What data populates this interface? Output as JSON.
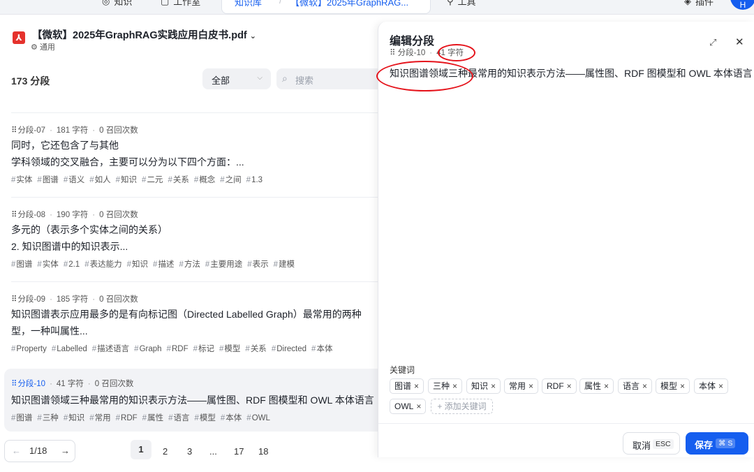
{
  "topbar": {
    "nav1": "知识",
    "nav2": "工作室",
    "tab_left": "知识库",
    "tab_right": "【微软】2025年GraphRAG...",
    "nav3": "工具",
    "plugins": "插件",
    "avatar": "H"
  },
  "doc": {
    "title": "【微软】2025年GraphRAG实践应用白皮书.pdf",
    "chevron": "⌄",
    "subtitle": "通用"
  },
  "list": {
    "count": "173 分段",
    "filter": "全部",
    "search_placeholder": "搜索"
  },
  "segments": [
    {
      "id": "分段-07",
      "chars": "181 字符",
      "recalls": "0 召回次数",
      "lines": [
        "同时，它还包含了与其他",
        "学科领域的交叉融合，主要可以分为以下四个方面：..."
      ],
      "tags": [
        "实体",
        "图谱",
        "语义",
        "如人",
        "知识",
        "二元",
        "关系",
        "概念",
        "之间",
        "1.3"
      ]
    },
    {
      "id": "分段-08",
      "chars": "190 字符",
      "recalls": "0 召回次数",
      "lines": [
        "多元的（表示多个实体之间的关系）",
        "2. 知识图谱中的知识表示..."
      ],
      "tags": [
        "图谱",
        "实体",
        "2.1",
        "表达能力",
        "知识",
        "描述",
        "方法",
        "主要用途",
        "表示",
        "建模"
      ]
    },
    {
      "id": "分段-09",
      "chars": "185 字符",
      "recalls": "0 召回次数",
      "lines": [
        "知识图谱表示应用最多的是有向标记图（Directed Labelled Graph）最常用的两种",
        "型，一种叫属性..."
      ],
      "tags": [
        "Property",
        "Labelled",
        "描述语言",
        "Graph",
        "RDF",
        "标记",
        "模型",
        "关系",
        "Directed",
        "本体"
      ]
    },
    {
      "id": "分段-10",
      "chars": "41 字符",
      "recalls": "0 召回次数",
      "lines": [
        "知识图谱领域三种最常用的知识表示方法——属性图、RDF 图模型和 OWL 本体语言"
      ],
      "tags": [
        "图谱",
        "三种",
        "知识",
        "常用",
        "RDF",
        "属性",
        "语言",
        "模型",
        "本体",
        "OWL"
      ]
    }
  ],
  "pager": {
    "current": "1/18",
    "pages": [
      "1",
      "2",
      "3",
      "...",
      "17",
      "18"
    ]
  },
  "panel": {
    "title": "编辑分段",
    "segment_id": "分段-10",
    "chars": "41 字符",
    "content": "知识图谱领域三种最常用的知识表示方法——属性图、RDF 图模型和 OWL 本体语言",
    "keywords_label": "关键词",
    "keywords": [
      "图谱",
      "三种",
      "知识",
      "常用",
      "RDF",
      "属性",
      "语言",
      "模型",
      "本体",
      "OWL"
    ],
    "add_keyword": "+ 添加关键词",
    "cancel": "取消",
    "cancel_key": "ESC",
    "save": "保存",
    "save_key": "⌘ S"
  },
  "colors": {
    "accent": "#155eef",
    "highlight_annotation": "#e5131b",
    "pdf_icon": "#e5322d"
  }
}
